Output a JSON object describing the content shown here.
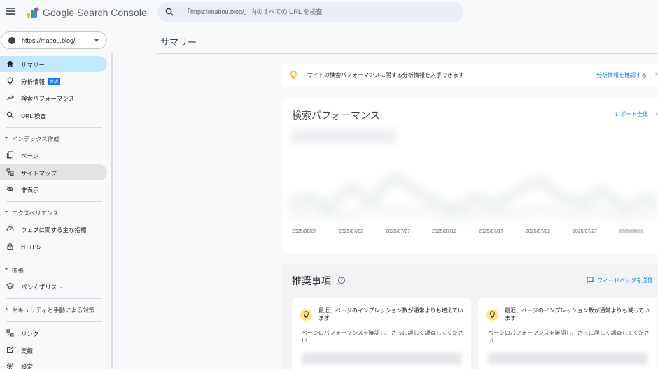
{
  "app": {
    "title": "Google Search Console"
  },
  "search": {
    "placeholder": "「https://mabou.blog/」内のすべての URL を検査"
  },
  "property": {
    "label": "https://mabou.blog/"
  },
  "sidebar": {
    "items": [
      {
        "label": "サマリー",
        "icon": "home-icon",
        "active": true
      },
      {
        "label": "分析情報",
        "icon": "lightbulb-icon",
        "badge": "新規"
      },
      {
        "label": "検索パフォーマンス",
        "icon": "trending-up-icon"
      },
      {
        "label": "URL 検査",
        "icon": "search-icon"
      }
    ],
    "sections": {
      "index": {
        "label": "インデックス作成",
        "items": [
          {
            "label": "ページ",
            "icon": "pages-icon"
          },
          {
            "label": "サイトマップ",
            "icon": "sitemap-icon"
          },
          {
            "label": "非表示",
            "icon": "eye-off-icon"
          }
        ]
      },
      "experience": {
        "label": "エクスペリエンス",
        "items": [
          {
            "label": "ウェブに関する主な指標",
            "icon": "speed-icon"
          },
          {
            "label": "HTTPS",
            "icon": "lock-icon"
          }
        ]
      },
      "enhancements": {
        "label": "拡張",
        "items": [
          {
            "label": "パンくずリスト",
            "icon": "layers-icon"
          }
        ]
      },
      "security": {
        "label": "セキュリティと手動による対策"
      },
      "bottom": [
        {
          "label": "リンク",
          "icon": "links-icon"
        },
        {
          "label": "実績",
          "icon": "open-external-icon"
        },
        {
          "label": "設定",
          "icon": "settings-icon"
        }
      ]
    }
  },
  "main": {
    "page_title": "サマリー",
    "insight": {
      "text": "サイトの検索パフォーマンスに関する分析情報を入手できます",
      "link": "分析情報を確認する",
      "chevron": "›"
    },
    "performance": {
      "title": "検索パフォーマンス",
      "link": "レポート全体",
      "chevron": "›",
      "x_ticks": [
        "2025/06/27",
        "2025/07/02",
        "2025/07/07",
        "2025/07/12",
        "2025/07/17",
        "2025/07/22",
        "2025/07/27",
        "2025/08/01"
      ]
    },
    "recommendations": {
      "title": "推奨事項",
      "help": "?",
      "feedback": "フィードバックを送信",
      "items": [
        {
          "headline": "最近、ページのインプレッション数が通常よりも増えています",
          "desc": "ページのパフォーマンスを確認し、さらに詳しく調査してください"
        },
        {
          "headline": "最近、ページのインプレッション数が通常よりも減っています",
          "desc": "ページのパフォーマンスを確認し、さらに詳しく調査してください"
        }
      ]
    }
  },
  "colors": {
    "accent": "#1a73e8",
    "active_nav": "#c2e7ff",
    "background": "#f8f9fa",
    "bulb_badge": "#fde293"
  }
}
